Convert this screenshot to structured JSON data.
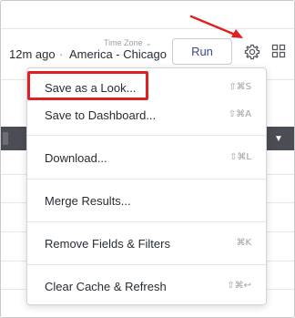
{
  "header": {
    "last_run": "12m ago",
    "separator": "·",
    "timezone_label": "Time Zone",
    "timezone_chevron": "⌄",
    "timezone_value": "America - Chicago",
    "run_label": "Run"
  },
  "menu": {
    "items": [
      {
        "label": "Save as a Look...",
        "shortcut": "⇧⌘S",
        "highlighted": true
      },
      {
        "label": "Save to Dashboard...",
        "shortcut": "⇧⌘A"
      },
      {
        "label": "Download...",
        "shortcut": "⇧⌘L"
      },
      {
        "label": "Merge Results...",
        "shortcut": ""
      },
      {
        "label": "Remove Fields & Filters",
        "shortcut": "⌘K"
      },
      {
        "label": "Clear Cache & Refresh",
        "shortcut": "⇧⌘↩"
      }
    ]
  },
  "icons": {
    "settings": "gear-icon",
    "apps": "grid-icon"
  },
  "colors": {
    "annotation_red": "#e02020",
    "run_text": "#3c4a8a",
    "dark_bar": "#4a4d55"
  }
}
